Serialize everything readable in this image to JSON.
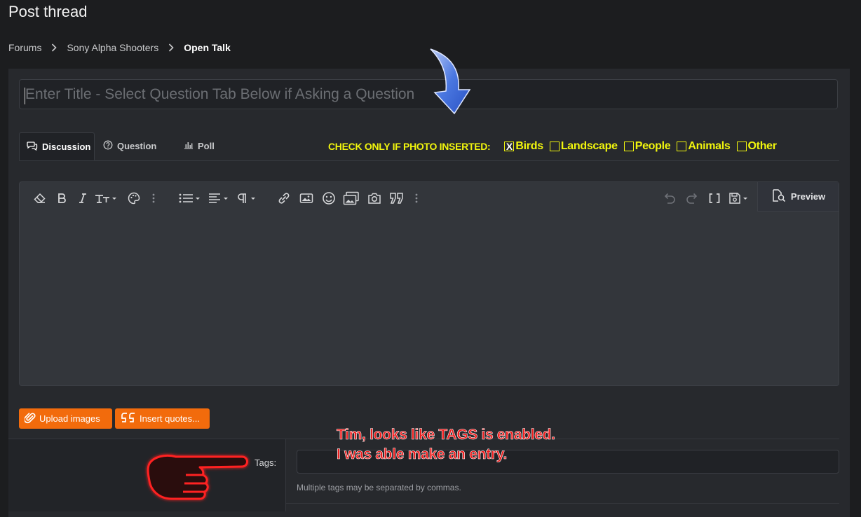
{
  "page": {
    "title": "Post thread"
  },
  "breadcrumb": [
    {
      "label": "Forums"
    },
    {
      "label": "Sony Alpha Shooters"
    },
    {
      "label": "Open Talk"
    }
  ],
  "thread_form": {
    "title_placeholder": "Enter Title - Select Question Tab Below if Asking a Question",
    "tabs": [
      {
        "label": "Discussion",
        "icon": "chat-bubbles-icon",
        "active": true
      },
      {
        "label": "Question",
        "icon": "question-circle-icon",
        "active": false
      },
      {
        "label": "Poll",
        "icon": "bar-chart-icon",
        "active": false
      }
    ],
    "photo_check": {
      "lead": "CHECK ONLY IF PHOTO INSERTED:",
      "options": [
        {
          "label": "Birds",
          "checked": true,
          "mark": "X"
        },
        {
          "label": "Landscape",
          "checked": false
        },
        {
          "label": "People",
          "checked": false
        },
        {
          "label": "Animals",
          "checked": false
        },
        {
          "label": "Other",
          "checked": false
        }
      ],
      "color": "#f1f50d"
    },
    "toolbar": {
      "preview_label": "Preview"
    },
    "buttons": {
      "upload_images": "Upload images",
      "insert_quotes": "Insert quotes..."
    },
    "tags": {
      "label": "Tags:",
      "value": "",
      "hint": "Multiple tags may be separated by commas."
    }
  },
  "annotation": {
    "line1": "Tim, looks like TAGS is enabled.",
    "line2": "I was able make an entry."
  },
  "colors": {
    "background": "#1c1d1f",
    "panel": "#27292d",
    "editor": "#33363b",
    "accent_button": "#f26b0c",
    "annotation_text": "#ee1c1c"
  }
}
